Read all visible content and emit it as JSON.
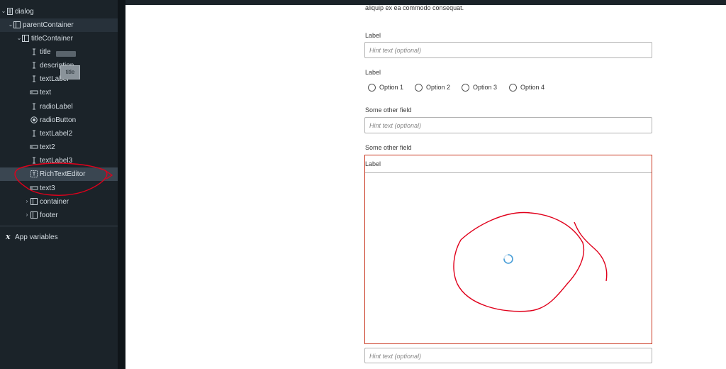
{
  "sidebar": {
    "tree": [
      {
        "label": "dialog",
        "icon": "page-icon",
        "expand": "expanded"
      },
      {
        "label": "parentContainer",
        "icon": "container-icon",
        "expand": "expanded"
      },
      {
        "label": "titleContainer",
        "icon": "container-icon",
        "expand": "expanded"
      },
      {
        "label": "title",
        "icon": "text-cursor-icon"
      },
      {
        "label": "description",
        "icon": "text-cursor-icon"
      },
      {
        "label": "textLabel",
        "icon": "text-cursor-icon"
      },
      {
        "label": "text",
        "icon": "input-field-icon"
      },
      {
        "label": "radioLabel",
        "icon": "text-cursor-icon"
      },
      {
        "label": "radioButton",
        "icon": "radio-icon"
      },
      {
        "label": "textLabel2",
        "icon": "text-cursor-icon"
      },
      {
        "label": "text2",
        "icon": "input-field-icon"
      },
      {
        "label": "textLabel3",
        "icon": "text-cursor-icon"
      },
      {
        "label": "RichTextEditor",
        "icon": "rich-text-icon"
      },
      {
        "label": "text3",
        "icon": "input-field-icon"
      },
      {
        "label": "container",
        "icon": "container-icon",
        "expand": "collapsed"
      },
      {
        "label": "footer",
        "icon": "container-icon",
        "expand": "collapsed"
      }
    ],
    "app_variables_label": "App variables",
    "tooltip": "title"
  },
  "form": {
    "truncated_text": "aliquip ex ea commodo consequat.",
    "field1": {
      "label": "Label",
      "placeholder": "Hint text (optional)"
    },
    "radio_group": {
      "label": "Label",
      "options": [
        "Option 1",
        "Option 2",
        "Option 3",
        "Option 4"
      ]
    },
    "field2": {
      "label": "Some other field",
      "placeholder": "Hint text (optional)"
    },
    "field3": {
      "label": "Some other field"
    },
    "rich_text_editor": {
      "label": "Label",
      "border_color": "#c9361f"
    },
    "hint_input": {
      "placeholder": "Hint text (optional)"
    }
  },
  "colors": {
    "sidebar_bg": "#1b2329",
    "annotation": "#e0001b",
    "spinner": "#4a9fd8"
  }
}
